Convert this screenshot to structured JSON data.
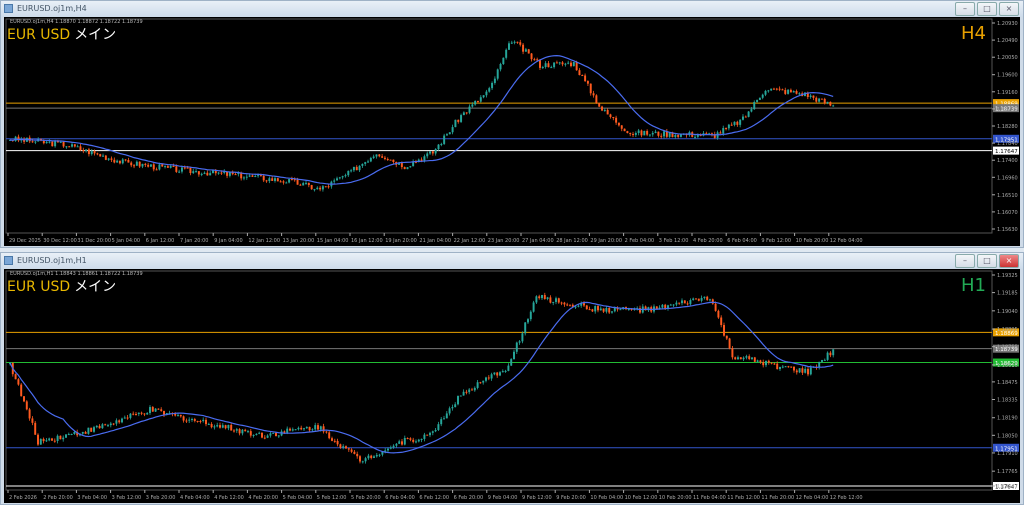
{
  "windows": [
    {
      "title": "EURUSD.oj1m,H4",
      "info": "EURUSD.oj1m,H4  1.18870 1.18872 1.18722 1.18739",
      "symbol": "EUR USD",
      "label": "メイン",
      "timeframe": "H4",
      "timeframe_color": "#e8a000",
      "y_ticks": [
        1.2093,
        1.2049,
        1.2005,
        1.196,
        1.1916,
        1.1872,
        1.1828,
        1.1784,
        1.174,
        1.1696,
        1.1651,
        1.1607,
        1.1563
      ],
      "x_ticks": [
        "29 Dec 2025",
        "30 Dec 12:00",
        "31 Dec 20:00",
        "5 Jan 04:00",
        "6 Jan 12:00",
        "7 Jan 20:00",
        "9 Jan 04:00",
        "12 Jan 12:00",
        "13 Jan 20:00",
        "15 Jan 04:00",
        "16 Jan 12:00",
        "19 Jan 20:00",
        "21 Jan 04:00",
        "22 Jan 12:00",
        "23 Jan 20:00",
        "27 Jan 04:00",
        "28 Jan 12:00",
        "29 Jan 20:00",
        "2 Feb 04:00",
        "3 Feb 12:00",
        "4 Feb 20:00",
        "6 Feb 04:00",
        "9 Feb 12:00",
        "10 Feb 20:00",
        "12 Feb 04:00"
      ],
      "levels": [
        {
          "price": "1.18869",
          "color": "#e8a000"
        },
        {
          "price": "1.18739",
          "color": "#777777"
        },
        {
          "price": "1.17951",
          "color": "#3355cc"
        },
        {
          "price": "1.17647",
          "color": "#ffffff"
        }
      ],
      "price_path": [
        [
          0,
          1.1795
        ],
        [
          20,
          1.178
        ],
        [
          40,
          1.1735
        ],
        [
          60,
          1.1715
        ],
        [
          80,
          1.1702
        ],
        [
          100,
          1.1685
        ],
        [
          110,
          1.1665
        ],
        [
          120,
          1.1705
        ],
        [
          130,
          1.176
        ],
        [
          140,
          1.1725
        ],
        [
          150,
          1.176
        ],
        [
          160,
          1.1855
        ],
        [
          170,
          1.192
        ],
        [
          178,
          1.205
        ],
        [
          188,
          1.1985
        ],
        [
          200,
          1.199
        ],
        [
          210,
          1.187
        ],
        [
          220,
          1.181
        ],
        [
          250,
          1.1805
        ],
        [
          260,
          1.1845
        ],
        [
          268,
          1.1925
        ],
        [
          282,
          1.191
        ],
        [
          292,
          1.188
        ]
      ]
    },
    {
      "title": "EURUSD.oj1m,H1",
      "info": "EURUSD.oj1m,H1  1.18843 1.18861 1.18722 1.18739",
      "symbol": "EUR USD",
      "label": "メイン",
      "timeframe": "H1",
      "timeframe_color": "#22aa55",
      "y_ticks": [
        1.19325,
        1.19185,
        1.1904,
        1.18895,
        1.18755,
        1.1861,
        1.18475,
        1.18335,
        1.1819,
        1.1805,
        1.1791,
        1.17765,
        1.17647
      ],
      "x_ticks": [
        "2 Feb 2026",
        "2 Feb 20:00",
        "3 Feb 04:00",
        "3 Feb 12:00",
        "3 Feb 20:00",
        "4 Feb 04:00",
        "4 Feb 12:00",
        "4 Feb 20:00",
        "5 Feb 04:00",
        "5 Feb 12:00",
        "5 Feb 20:00",
        "6 Feb 04:00",
        "6 Feb 12:00",
        "6 Feb 20:00",
        "9 Feb 04:00",
        "9 Feb 12:00",
        "9 Feb 20:00",
        "10 Feb 04:00",
        "10 Feb 12:00",
        "10 Feb 20:00",
        "11 Feb 04:00",
        "11 Feb 12:00",
        "11 Feb 20:00",
        "12 Feb 04:00",
        "12 Feb 12:00"
      ],
      "levels": [
        {
          "price": "1.18869",
          "color": "#e8a000"
        },
        {
          "price": "1.18739",
          "color": "#777777"
        },
        {
          "price": "1.18629",
          "color": "#22bb33"
        },
        {
          "price": "1.17951",
          "color": "#3355cc"
        },
        {
          "price": "1.17647",
          "color": "#ffffff"
        }
      ],
      "price_path": [
        [
          0,
          1.1862
        ],
        [
          10,
          1.18
        ],
        [
          30,
          1.181
        ],
        [
          50,
          1.1825
        ],
        [
          70,
          1.1815
        ],
        [
          90,
          1.1805
        ],
        [
          110,
          1.1812
        ],
        [
          125,
          1.1785
        ],
        [
          140,
          1.18
        ],
        [
          150,
          1.1805
        ],
        [
          160,
          1.1835
        ],
        [
          178,
          1.186
        ],
        [
          188,
          1.1915
        ],
        [
          210,
          1.1905
        ],
        [
          230,
          1.1905
        ],
        [
          250,
          1.1915
        ],
        [
          258,
          1.1868
        ],
        [
          270,
          1.1862
        ],
        [
          285,
          1.1855
        ],
        [
          294,
          1.1872
        ]
      ]
    }
  ],
  "colors": {
    "bull": "#26a69a",
    "bear": "#ff5a1f",
    "ma": "#4a6cf0"
  }
}
